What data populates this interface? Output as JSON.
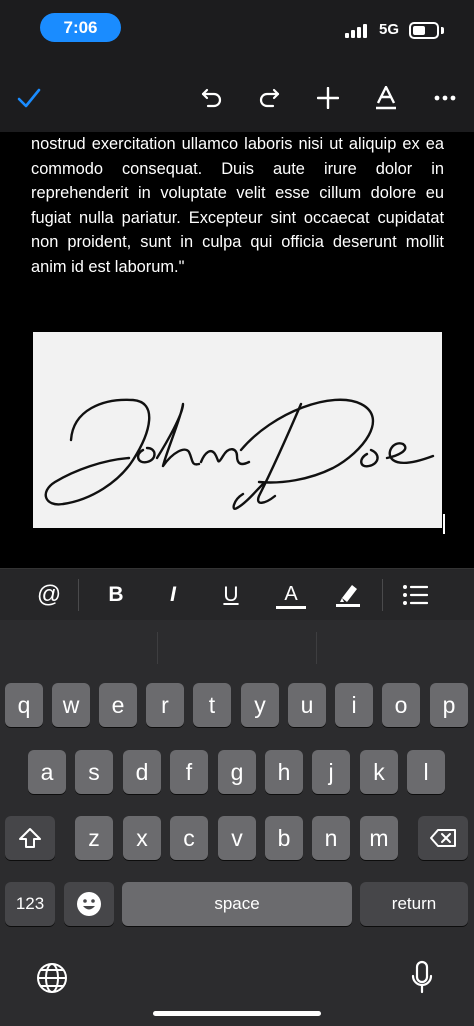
{
  "status": {
    "time": "7:06",
    "network": "5G"
  },
  "toolbar": {
    "done_icon": "checkmark-icon",
    "undo_icon": "undo-icon",
    "redo_icon": "redo-icon",
    "insert_icon": "plus-icon",
    "text_format_icon": "text-format-icon",
    "more_icon": "more-icon",
    "accent_color": "#1a8cff"
  },
  "document": {
    "text": "nostrud exercitation ullamco laboris nisi ut aliquip ex ea commodo consequat. Duis aute irure dolor in reprehenderit in voluptate velit esse cillum dolore eu fugiat nulla pariatur. Excepteur sint occaecat cupidatat non proident, sunt in culpa qui officia deserunt mollit anim id est laborum.\"",
    "signature": "John Doe"
  },
  "format_bar": {
    "mention": "@",
    "bold": "B",
    "italic": "I",
    "underline": "U",
    "text_color": "A",
    "highlight_icon": "highlighter-icon",
    "list_icon": "list-icon"
  },
  "keyboard": {
    "row1": [
      "q",
      "w",
      "e",
      "r",
      "t",
      "y",
      "u",
      "i",
      "o",
      "p"
    ],
    "row2": [
      "a",
      "s",
      "d",
      "f",
      "g",
      "h",
      "j",
      "k",
      "l"
    ],
    "row3": [
      "z",
      "x",
      "c",
      "v",
      "b",
      "n",
      "m"
    ],
    "numbers_label": "123",
    "space_label": "space",
    "return_label": "return"
  }
}
